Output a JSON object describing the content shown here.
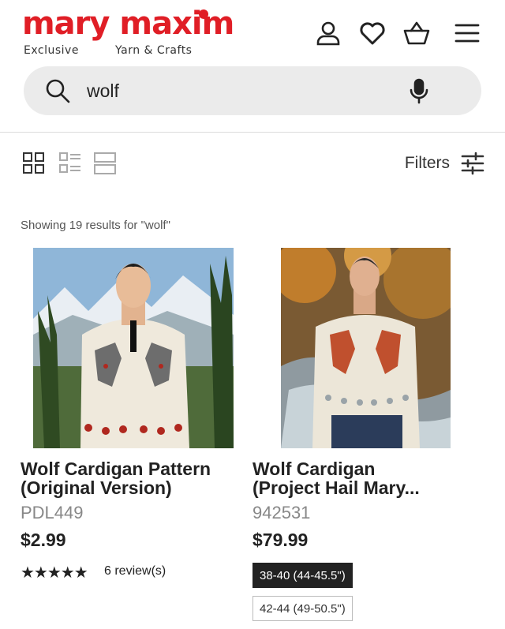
{
  "brand": {
    "name": "mary maxim",
    "tagline_left": "Exclusive",
    "tagline_right": "Yarn & Crafts",
    "color": "#e01e26"
  },
  "header": {
    "icons": [
      "account-icon",
      "wishlist-heart-icon",
      "cart-basket-icon",
      "menu-icon"
    ]
  },
  "search": {
    "value": "wolf",
    "icon": "search-icon",
    "mic_icon": "microphone-icon"
  },
  "toolbar": {
    "views": [
      "grid-view-icon",
      "list-view-icon",
      "large-view-icon"
    ],
    "filters_label": "Filters"
  },
  "results": {
    "text": "Showing 19 results for \"wolf\""
  },
  "products": [
    {
      "title_line1": "Wolf Cardigan Pattern",
      "title_line2": "(Original Version)",
      "sku": "PDL449",
      "price": "$2.99",
      "stars": "★★★★★",
      "rating": 5,
      "reviews": "6 review(s)"
    },
    {
      "title_line1": "Wolf Cardigan",
      "title_line2": "(Project Hail Mary...",
      "sku": "942531",
      "price": "$79.99",
      "sizes": [
        {
          "label": "38-40 (44-45.5\")",
          "selected": true
        },
        {
          "label": "42-44 (49-50.5\")",
          "selected": false
        }
      ]
    }
  ]
}
